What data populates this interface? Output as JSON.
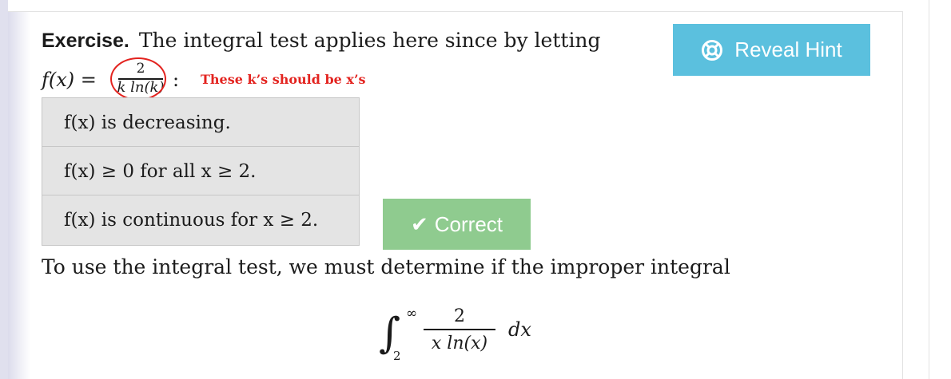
{
  "exercise": {
    "label": "Exercise.",
    "intro": "The integral test applies here since by letting"
  },
  "function_def": {
    "lhs": "f(x) =",
    "numerator": "2",
    "denominator": "k ln(k)",
    "colon": ":",
    "annotation": "These k’s should be x’s"
  },
  "checklist": [
    {
      "text": "f(x) is decreasing."
    },
    {
      "text": "f(x) ≥ 0 for all x ≥ 2."
    },
    {
      "text": "f(x) is continuous for x ≥ 2."
    }
  ],
  "hint_button": {
    "label": "Reveal Hint",
    "icon": "lifebuoy-icon"
  },
  "correct_button": {
    "label": "Correct",
    "icon": "checkmark-icon"
  },
  "integral_text": "To use the integral test, we must determine if the improper integral",
  "display_integral": {
    "upper": "∞",
    "lower": "2",
    "numerator": "2",
    "denominator": "x ln(x)",
    "differential": "dx"
  },
  "colors": {
    "hint": "#5bc0de",
    "correct": "#8fcb8f",
    "annotation": "#e3231f",
    "row_bg": "#e4e4e4"
  }
}
